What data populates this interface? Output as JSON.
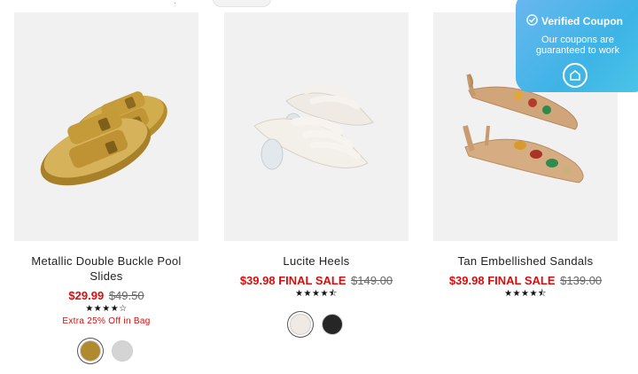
{
  "products": [
    {
      "name": "Metallic Double Buckle Pool Slides",
      "sale_price": "$29.99",
      "final_sale": "",
      "original_price": "$49.50",
      "rating": 4,
      "stars_text": "★★★★☆",
      "promo": "Extra 25% Off in Bag",
      "swatches": [
        "#b08a2e",
        "#d4d4d4"
      ]
    },
    {
      "name": "Lucite Heels",
      "sale_price": "$39.98",
      "final_sale": "FINAL SALE",
      "original_price": "$149.00",
      "rating": 4.5,
      "stars_text": "★★★★⯪",
      "promo": "",
      "swatches": [
        "#efeae3",
        "#262626"
      ]
    },
    {
      "name": "Tan Embellished Sandals",
      "sale_price": "$39.98",
      "final_sale": "FINAL SALE",
      "original_price": "$139.00",
      "rating": 4.5,
      "stars_text": "★★★★⯪",
      "promo": "",
      "swatches": []
    }
  ],
  "coupon": {
    "title": "Verified Coupon",
    "message": "Our coupons are guaranteed to work",
    "icon": "shield-check-icon"
  },
  "colors": {
    "sale": "#d50e0e",
    "coupon_bg": "#3db4e6"
  }
}
